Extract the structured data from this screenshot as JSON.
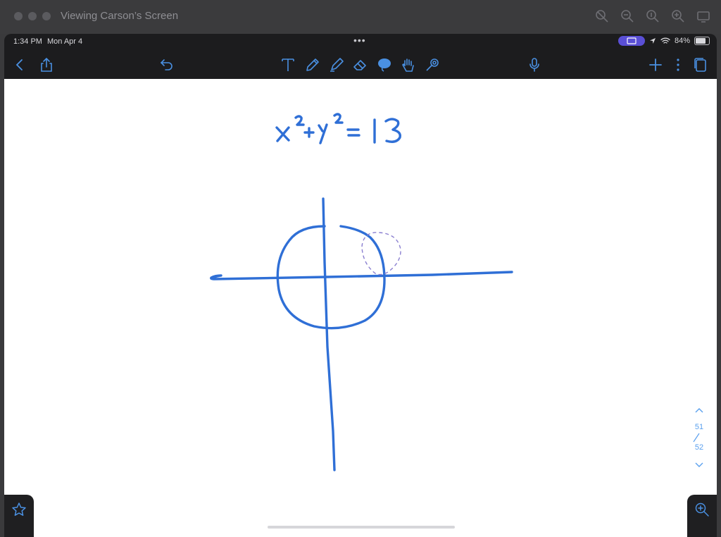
{
  "window": {
    "title": "Viewing Carson’s Screen"
  },
  "status_bar": {
    "time": "1:34 PM",
    "date": "Mon Apr 4",
    "battery": "84%"
  },
  "toolbar": {
    "icons": [
      "back-icon",
      "share-icon",
      "undo-icon",
      "text-tool-icon",
      "pen-tool-icon",
      "highlighter-tool-icon",
      "eraser-tool-icon",
      "lasso-tool-icon",
      "hand-tool-icon",
      "laser-pointer-icon",
      "microphone-icon",
      "add-icon",
      "more-icon",
      "pages-icon"
    ]
  },
  "canvas": {
    "equation_text": "x²+y²=13"
  },
  "pager": {
    "current": "51",
    "total": "52"
  },
  "colors": {
    "accent": "#3b82e6",
    "ink": "#2f6fd6",
    "lasso": "#8a7fd0",
    "status_pill": "#5a4fd6"
  }
}
